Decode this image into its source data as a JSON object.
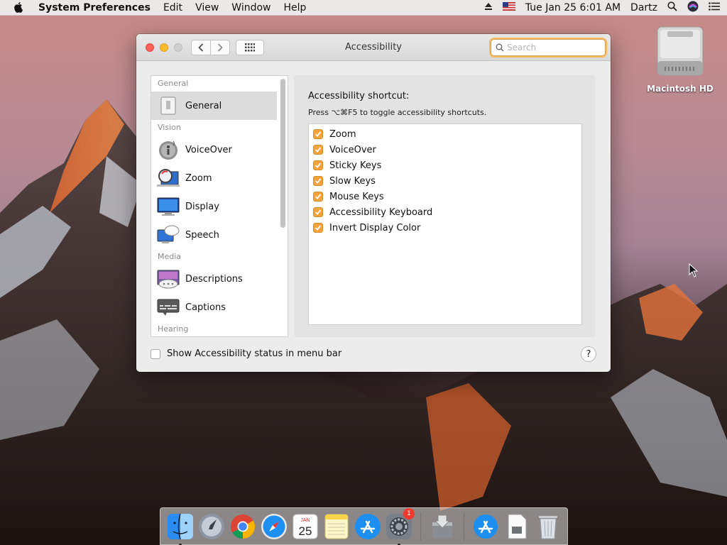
{
  "menubar": {
    "app_name": "System Preferences",
    "items": [
      "Edit",
      "View",
      "Window",
      "Help"
    ],
    "datetime": "Tue Jan 25  6:01 AM",
    "user": "Dartz"
  },
  "desktop": {
    "hd_label": "Macintosh HD"
  },
  "window": {
    "title": "Accessibility",
    "search_placeholder": "Search",
    "sidebar": {
      "sections": [
        {
          "label": "General",
          "items": [
            "General"
          ]
        },
        {
          "label": "Vision",
          "items": [
            "VoiceOver",
            "Zoom",
            "Display",
            "Speech"
          ]
        },
        {
          "label": "Media",
          "items": [
            "Descriptions",
            "Captions"
          ]
        },
        {
          "label": "Hearing",
          "items": []
        }
      ],
      "selected": "General"
    },
    "panel": {
      "heading": "Accessibility shortcut:",
      "subtext": "Press ⌥⌘F5 to toggle accessibility shortcuts.",
      "options": [
        {
          "label": "Zoom",
          "checked": true
        },
        {
          "label": "VoiceOver",
          "checked": true
        },
        {
          "label": "Sticky Keys",
          "checked": true
        },
        {
          "label": "Slow Keys",
          "checked": true
        },
        {
          "label": "Mouse Keys",
          "checked": true
        },
        {
          "label": "Accessibility Keyboard",
          "checked": true
        },
        {
          "label": "Invert Display Color",
          "checked": true
        }
      ]
    },
    "show_status_label": "Show Accessibility status in menu bar",
    "show_status_checked": false,
    "help_label": "?"
  },
  "dock": {
    "calendar_month": "JAN",
    "calendar_day": "25",
    "prefs_badge": "1"
  },
  "colors": {
    "accent": "#f2a33b",
    "selection": "#dcdcdc"
  }
}
